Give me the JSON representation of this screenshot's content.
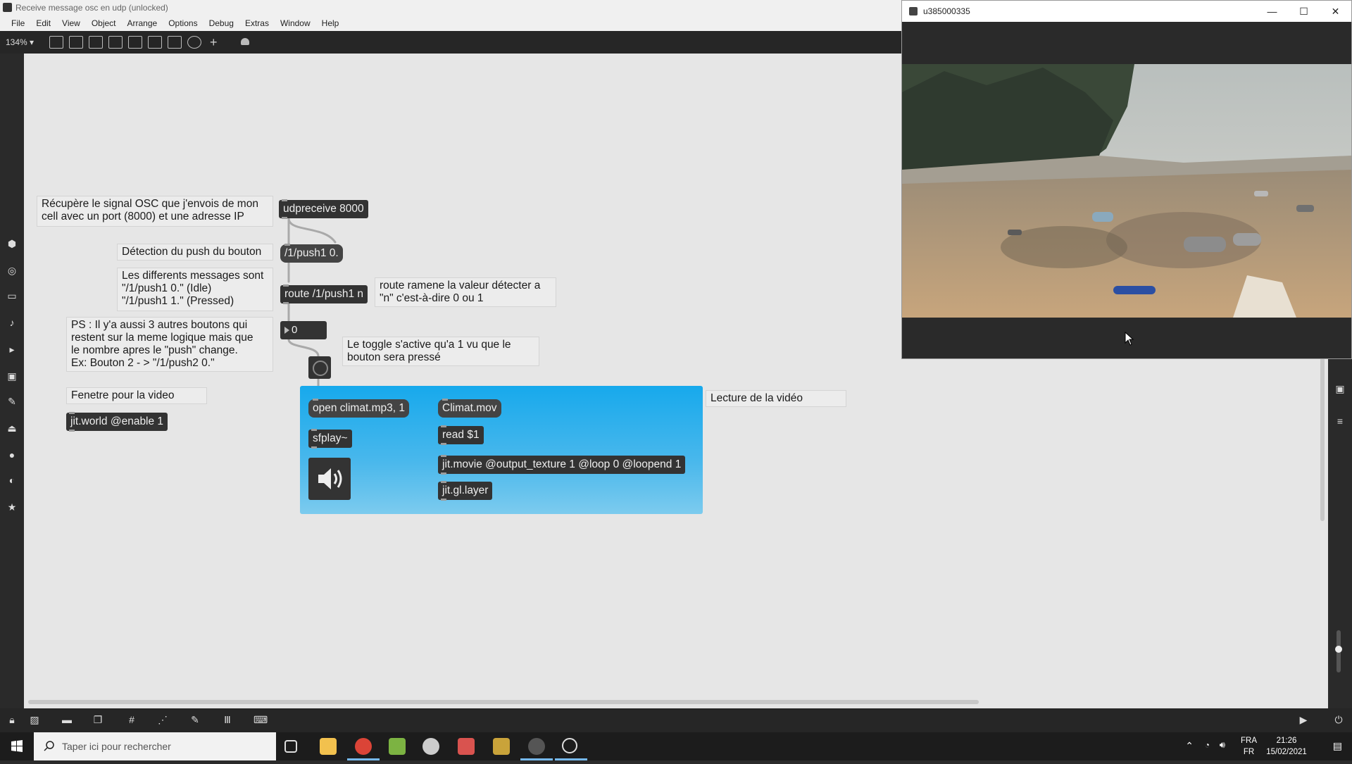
{
  "window": {
    "title": "Receive message osc en udp (unlocked)"
  },
  "menu": [
    "File",
    "Edit",
    "View",
    "Object",
    "Arrange",
    "Options",
    "Debug",
    "Extras",
    "Window",
    "Help"
  ],
  "toolbar": {
    "zoom": "134% ▾"
  },
  "patcher": {
    "comments": {
      "c1": "Récupère le signal OSC que j'envois de mon\ncell avec un port (8000) et une adresse IP",
      "c2": "Détection du push du bouton",
      "c3": "Les differents messages sont\n\"/1/push1 0.\" (Idle)\n\"/1/push1 1.\" (Pressed)",
      "c4": "PS : Il y'a aussi 3 autres boutons qui\nrestent sur la meme logique mais que\nle nombre apres le \"push\" change.\nEx: Bouton 2 - > \"/1/push2 0.\"",
      "c5": "route ramene la valeur détecter a\n\"n\" c'est-à-dire 0 ou 1",
      "c6": "Le toggle s'active qu'a 1 vu que le\nbouton sera pressé",
      "c7": "Fenetre pour la video",
      "c8": "Lecture de la vidéo"
    },
    "objects": {
      "udpreceive": "udpreceive 8000",
      "push_msg": "/1/push1 0.",
      "route": "route /1/push1 n",
      "jitworld": "jit.world @enable 1",
      "sfplay": "sfplay~",
      "read": "read $1",
      "jitmovie": "jit.movie @output_texture 1 @loop 0 @loopend 1",
      "glayer": "jit.gl.layer"
    },
    "messages": {
      "open": "open climat.mp3, 1",
      "movie": "Climat.mov"
    },
    "number_value": "0"
  },
  "video_window": {
    "title": "u385000335",
    "minimize": "—",
    "maximize": "☐",
    "close": "✕"
  },
  "taskbar": {
    "search_placeholder": "Taper ici pour rechercher",
    "lang_line1": "FRA",
    "lang_line2": "FR",
    "time": "21:26",
    "date": "15/02/2021"
  },
  "colors": {
    "panel_blue": "#17a9ec",
    "patcher_bg": "#e6e6e6",
    "object_dark": "#333333"
  }
}
